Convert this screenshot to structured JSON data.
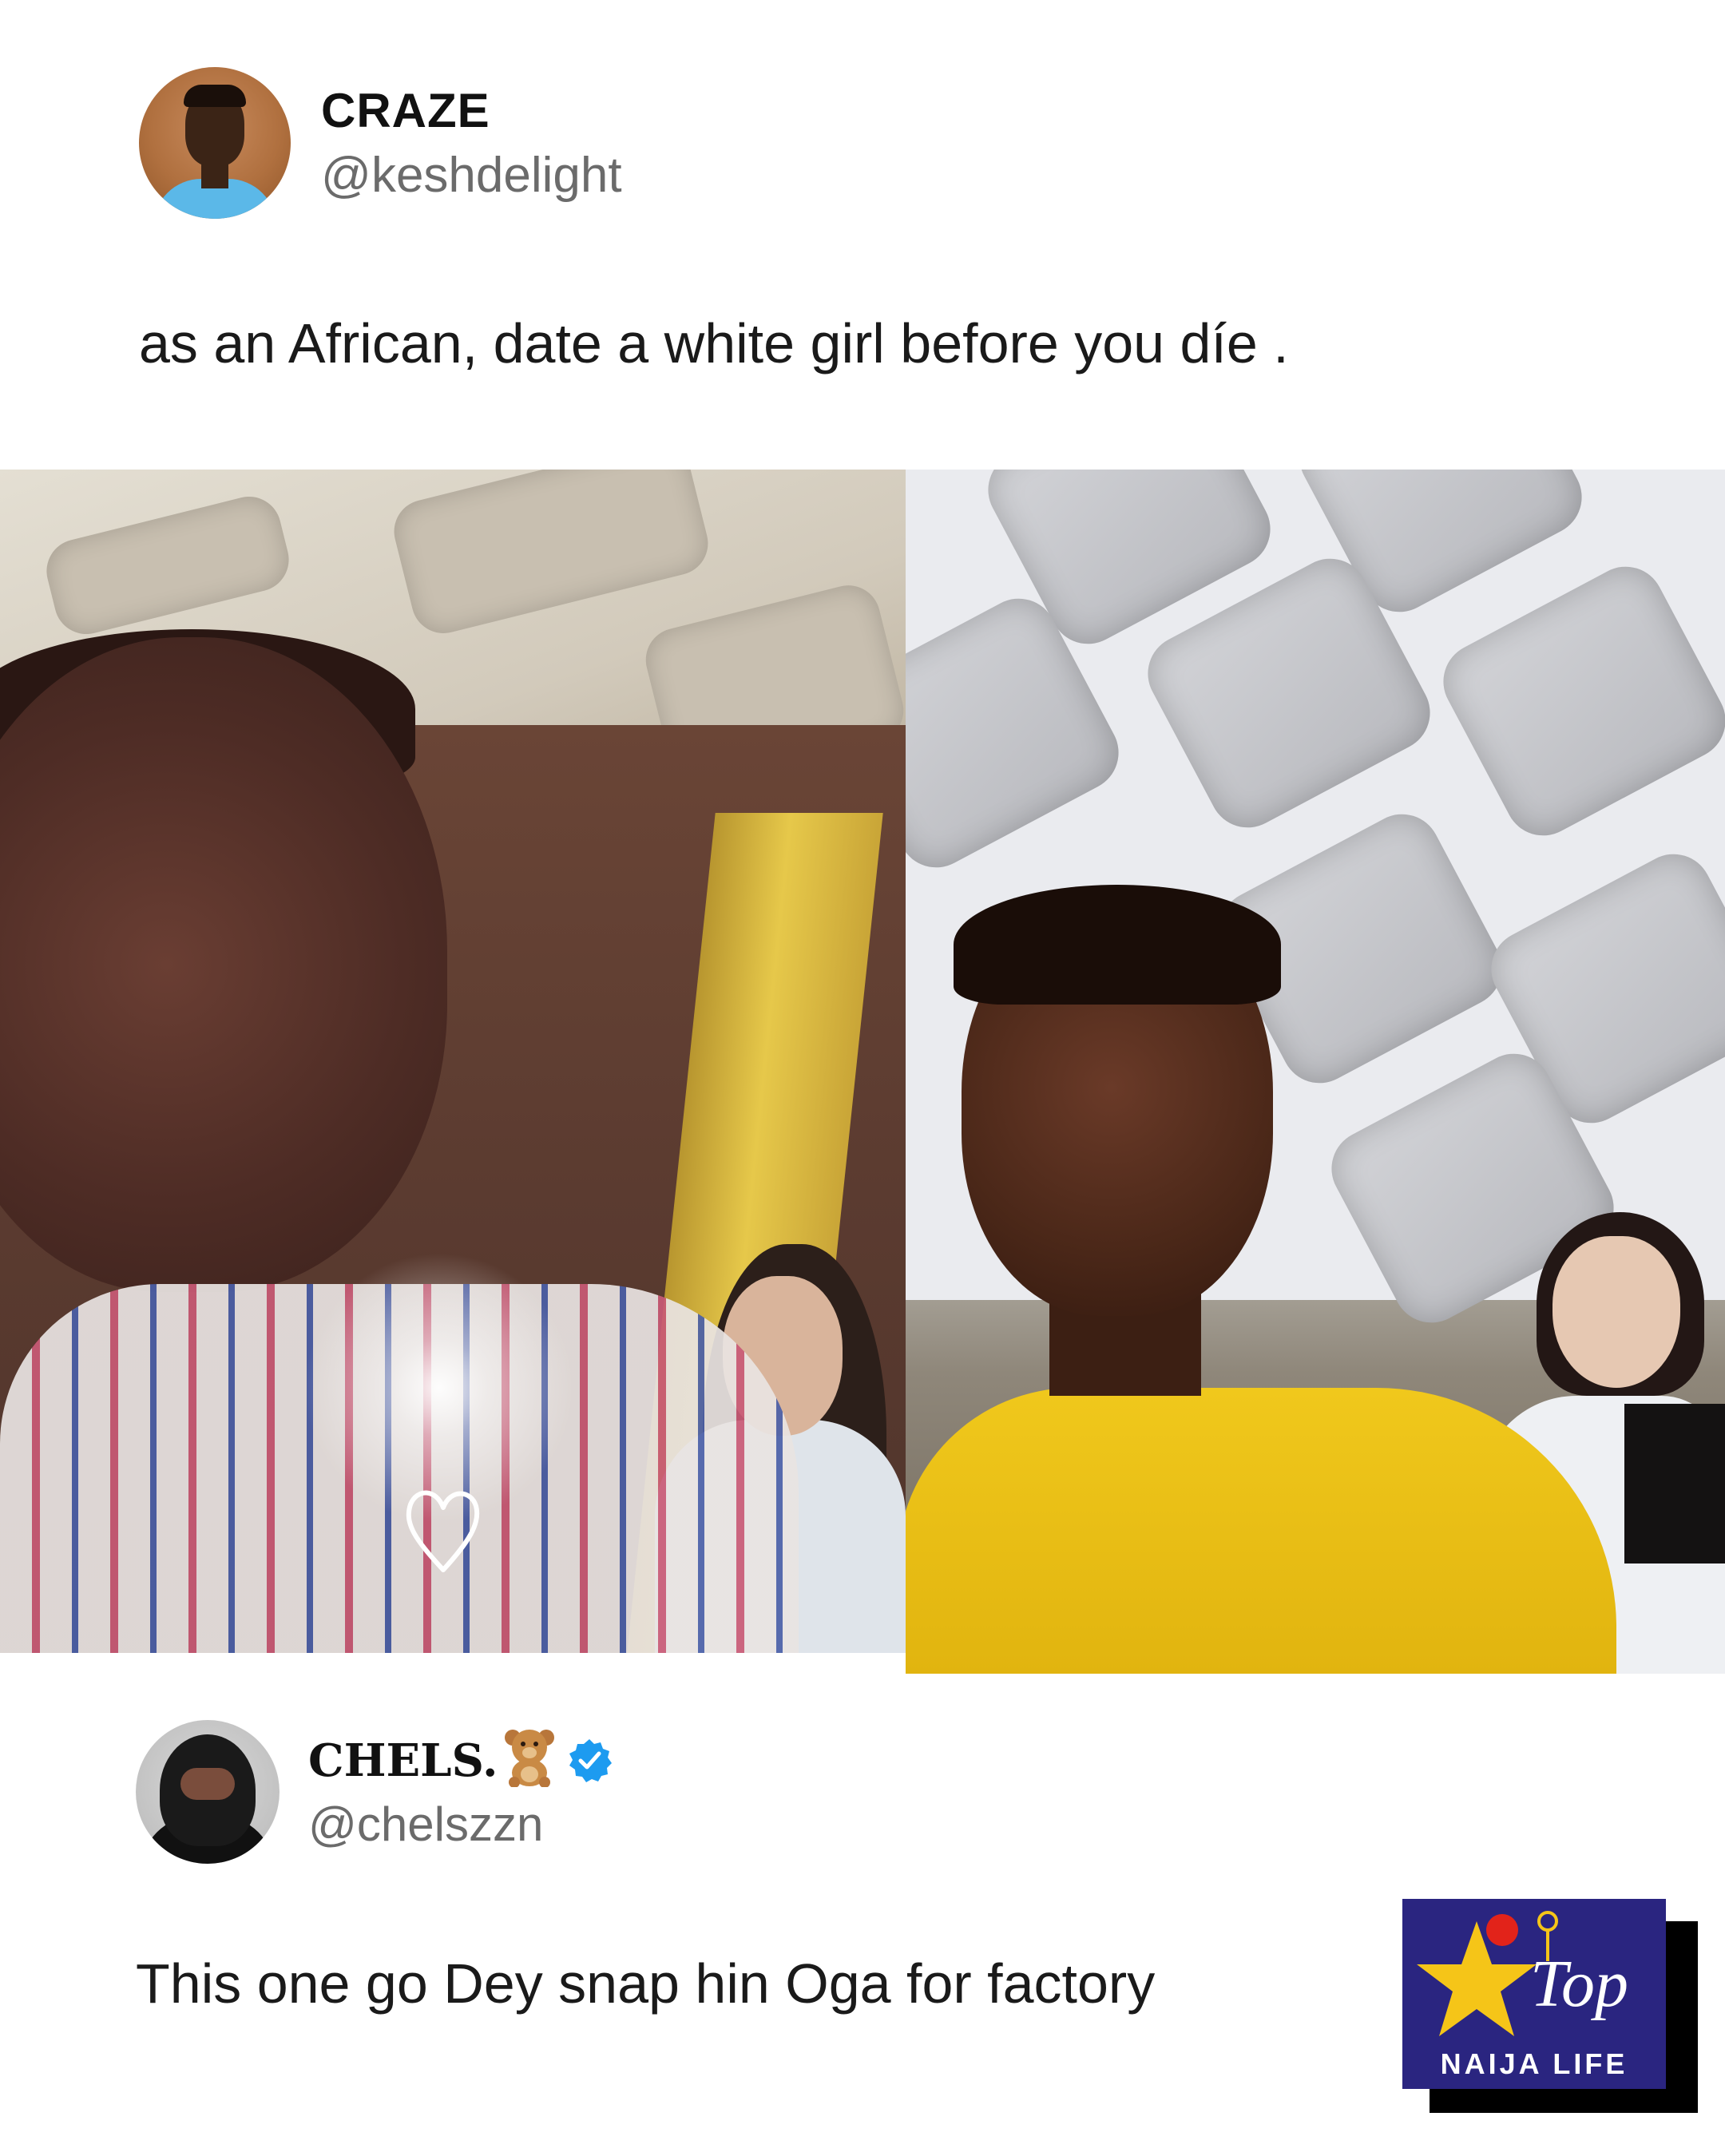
{
  "tweet1": {
    "display_name": "CRAZE",
    "handle": "@keshdelight",
    "text": "as an African, date a white girl before you díe ."
  },
  "tweet2": {
    "display_name": "CHELS.",
    "emoji": "🧸",
    "verified": true,
    "handle": "@chelszzn",
    "text": "This one go Dey snap hin Oga for factory"
  },
  "logo": {
    "main": "Top",
    "sub": "NAIJA LIFE"
  },
  "colors": {
    "handle_gray": "#6b6b6b",
    "verified_blue": "#1d9bf0",
    "logo_bg": "#2a2580",
    "logo_star": "#f5c518"
  }
}
